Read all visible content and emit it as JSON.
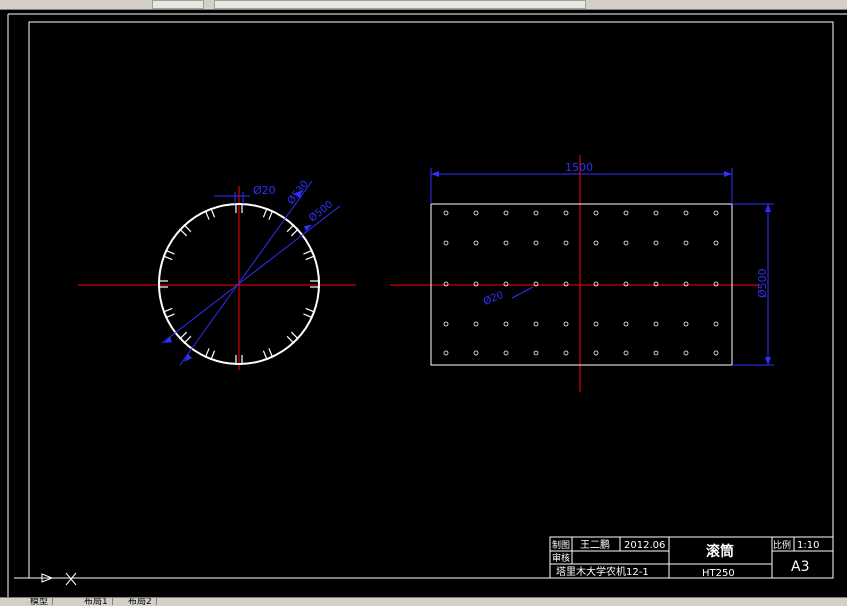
{
  "drawing": {
    "dimensions": {
      "width_length": "1500",
      "diameter_right": "Ø500",
      "hole_right": "Ø20",
      "hole_left": "Ø20",
      "diameter_outer": "Ø530",
      "diameter_inner": "Ø500"
    }
  },
  "title_block": {
    "drawn_label": "制图",
    "drawn_name": "王二鹏",
    "date": "2012.06",
    "check_label": "审核",
    "part_name": "滚筒",
    "scale_label": "比例",
    "scale_value": "1:10",
    "school": "塔里木大学农机12-1",
    "material": "HT250",
    "sheet_size": "A3"
  },
  "tabs": {
    "model": "模型",
    "layout1": "布局1",
    "layout2": "布局2"
  },
  "colors": {
    "background": "#000000",
    "border": "#ffffff",
    "center_line": "#ff0000",
    "dimension": "#0000ff"
  }
}
